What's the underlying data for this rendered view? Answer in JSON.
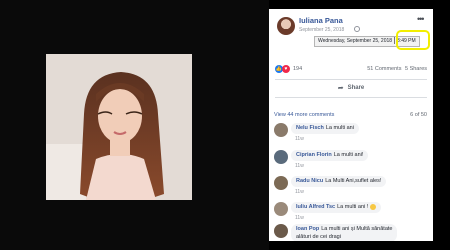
{
  "post": {
    "author": "Iuliana Pana",
    "date": "September 25, 2018",
    "tooltip_date": "Wednesday, September 25, 2018",
    "tooltip_time": "3:49 PM",
    "reaction_count": "194",
    "comments_count": "51 Comments",
    "shares_count": "5 Shares",
    "share_label": "Share"
  },
  "comments_section": {
    "view_more": "View 44 more comments",
    "count": "6 of 50",
    "items": [
      {
        "name": "Nelu Fisch",
        "text": "La multi ani",
        "time": "11w"
      },
      {
        "name": "Ciprian Florin",
        "text": "La multi ani!",
        "time": "11w"
      },
      {
        "name": "Radu Nicu",
        "text": "La Multi Ani,suflet ales!",
        "time": "11w"
      },
      {
        "name": "Iuliu Alfred Tsc",
        "text": "La multi ani !",
        "time": "11w"
      },
      {
        "name": "Ioan Pop",
        "text": "La multi ani și Multă sănătate",
        "text2": "alături de cei dragi",
        "time": "11w"
      }
    ]
  },
  "colors": {
    "link": "#385898",
    "highlight": "#f2ee00",
    "like": "#1877f2",
    "love": "#f0284a"
  }
}
